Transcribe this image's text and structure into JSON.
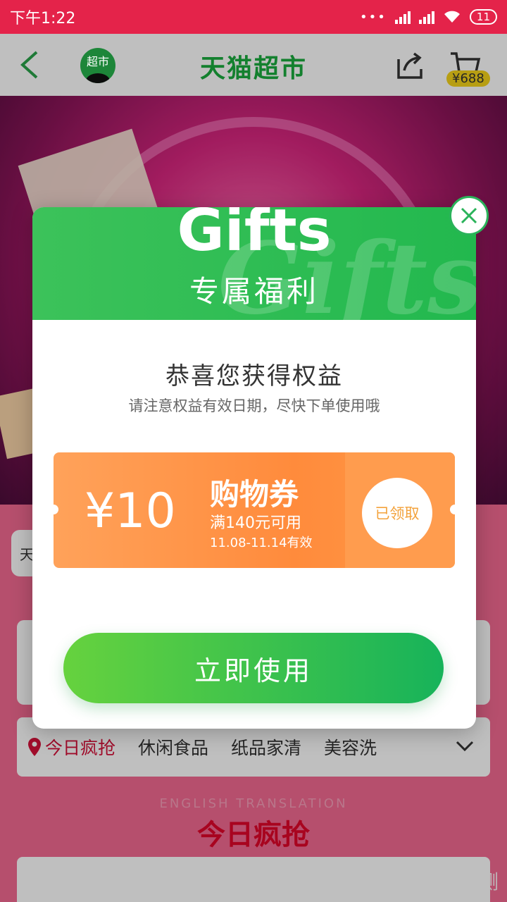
{
  "status_bar": {
    "time": "下午1:22",
    "battery": "11"
  },
  "header": {
    "title": "天猫超市",
    "avatar_label": "超市",
    "cart_amount": "¥688"
  },
  "background": {
    "side_chip": "天",
    "tabs": [
      {
        "label": "今日疯抢"
      },
      {
        "label": "休闲食品"
      },
      {
        "label": "纸品家清"
      },
      {
        "label": "美容洗"
      }
    ],
    "section_subtitle": "ENGLISH TRANSLATION",
    "section_title": "今日疯抢",
    "watermark": "新浪众测"
  },
  "modal": {
    "banner_word": "Gifts",
    "banner_subtitle": "专属福利",
    "title": "恭喜您获得权益",
    "note": "请注意权益有效日期，尽快下单使用哦",
    "coupon": {
      "amount": "¥10",
      "name": "购物券",
      "condition": "满140元可用",
      "validity": "11.08-11.14有效",
      "status": "已领取"
    },
    "action_label": "立即使用"
  },
  "colors": {
    "status_bar": "#e4234a",
    "brand_green": "#1aab3e",
    "coupon_orange": "#ff8b3c",
    "accent_red": "#d6123a"
  }
}
